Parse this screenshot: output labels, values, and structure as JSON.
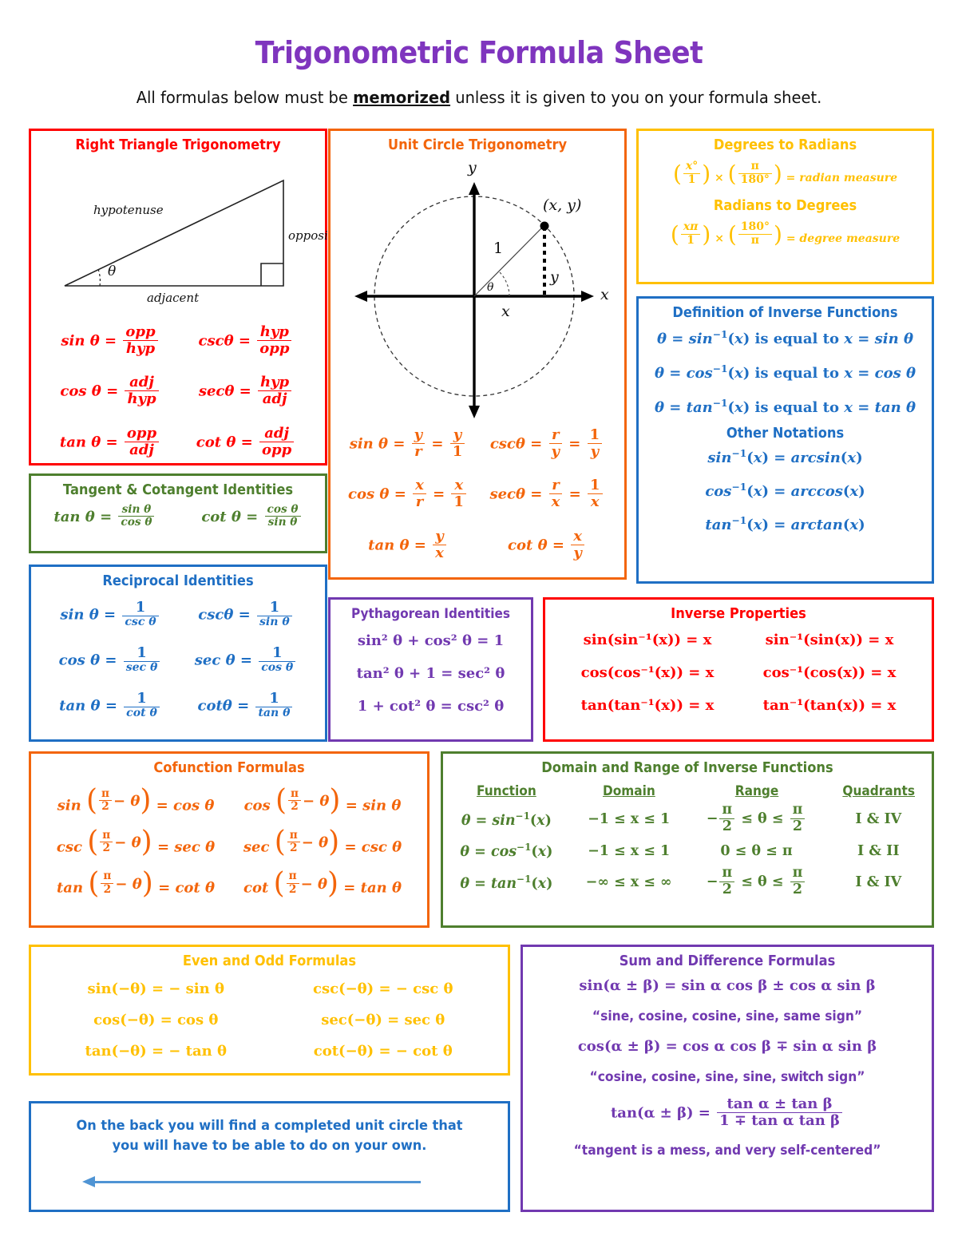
{
  "header": {
    "title": "Trigonometric Formula Sheet",
    "subtitle_before": "All formulas below must be ",
    "subtitle_emph": "memorized",
    "subtitle_after": " unless it is given to you on your formula sheet.",
    "title_color": "#7F35BE"
  },
  "colors": {
    "red": "#FF0000",
    "orange": "#F3650B",
    "gold": "#FFC000",
    "blue": "#1F6FC4",
    "green": "#4E7F2E",
    "purple": "#7139B0"
  },
  "right_triangle": {
    "title": "Right Triangle Trigonometry",
    "diagram_labels": {
      "hypotenuse": "hypotenuse",
      "opposite": "opposite",
      "adjacent": "adjacent",
      "angle": "θ"
    },
    "formulas": [
      {
        "left_fn": "sin",
        "left_num": "opp",
        "left_den": "hyp",
        "right_fn": "csc",
        "right_num": "hyp",
        "right_den": "opp"
      },
      {
        "left_fn": "cos",
        "left_num": "adj",
        "left_den": "hyp",
        "right_fn": "sec",
        "right_num": "hyp",
        "right_den": "adj"
      },
      {
        "left_fn": "tan",
        "left_num": "opp",
        "left_den": "adj",
        "right_fn": "cot",
        "right_num": "adj",
        "right_den": "opp"
      }
    ]
  },
  "unit_circle": {
    "title": "Unit Circle Trigonometry",
    "diagram_labels": {
      "y_axis": "y",
      "x_axis": "x",
      "point": "(x, y)",
      "radius": "1",
      "y_leg": "y",
      "x_leg": "x",
      "angle": "θ"
    },
    "formulas": [
      {
        "left_fn": "sin",
        "left_n1": "y",
        "left_d1": "r",
        "left_n2": "y",
        "left_d2": "1",
        "right_fn": "csc",
        "right_n1": "r",
        "right_d1": "y",
        "right_n2": "1",
        "right_d2": "y"
      },
      {
        "left_fn": "cos",
        "left_n1": "x",
        "left_d1": "r",
        "left_n2": "x",
        "left_d2": "1",
        "right_fn": "sec",
        "right_n1": "r",
        "right_d1": "x",
        "right_n2": "1",
        "right_d2": "x"
      }
    ],
    "tan_fn": "tan",
    "tan_num": "y",
    "tan_den": "x",
    "cot_fn": "cot",
    "cot_num": "x",
    "cot_den": "y"
  },
  "deg_rad": {
    "title_deg_to_rad": "Degrees to Radians",
    "deg_to_rad": {
      "n1": "x°",
      "d1": "1",
      "times": "×",
      "n2": "π",
      "d2": "180°",
      "result": "= radian measure"
    },
    "title_rad_to_deg": "Radians to Degrees",
    "rad_to_deg": {
      "n1": "xπ",
      "d1": "1",
      "times": "×",
      "n2": "180°",
      "d2": "π",
      "result": "= degree measure"
    }
  },
  "inverse_def": {
    "title": "Definition of Inverse Functions",
    "lines": [
      {
        "fn": "sin",
        "tail": "is equal to"
      },
      {
        "fn": "cos",
        "tail": "is equal to"
      },
      {
        "fn": "tan",
        "tail": "is equal to"
      }
    ],
    "other_notations_title": "Other Notations",
    "notations": [
      {
        "fn": "sin",
        "arc": "arcsin"
      },
      {
        "fn": "cos",
        "arc": "arccos"
      },
      {
        "fn": "tan",
        "arc": "arctan"
      }
    ]
  },
  "tan_cot": {
    "title": "Tangent & Cotangent Identities",
    "formulas": [
      {
        "fn": "tan",
        "num": "sin θ",
        "den": "cos θ"
      },
      {
        "fn": "cot",
        "num": "cos θ",
        "den": "sin θ"
      }
    ]
  },
  "reciprocal": {
    "title": "Reciprocal Identities",
    "formulas": [
      {
        "left_fn": "sin",
        "left_den": "csc θ",
        "right_fn": "csc",
        "right_den": "sin θ"
      },
      {
        "left_fn": "cos",
        "left_den": "sec θ",
        "right_fn": "sec",
        "right_den": "cos θ"
      },
      {
        "left_fn": "tan",
        "left_den": "cot θ",
        "right_fn": "cot",
        "right_den": "tan θ"
      }
    ],
    "one": "1"
  },
  "pythagorean": {
    "title": "Pythagorean Identities",
    "lines": [
      "sin² θ + cos² θ = 1",
      "tan² θ + 1 = sec² θ",
      "1 + cot² θ = csc² θ"
    ]
  },
  "inverse_properties": {
    "title": "Inverse Properties",
    "rows": [
      {
        "left": "sin(sin⁻¹(x)) = x",
        "right": "sin⁻¹(sin(x)) = x",
        "fn": "sin"
      },
      {
        "left": "cos(cos⁻¹(x)) = x",
        "right": "cos⁻¹(cos(x)) = x",
        "fn": "cos"
      },
      {
        "left": "tan(tan⁻¹(x)) = x",
        "right": "tan⁻¹(tan(x)) = x",
        "fn": "tan"
      }
    ]
  },
  "cofunction": {
    "title": "Cofunction Formulas",
    "rows": [
      {
        "left_fn": "sin",
        "left_res": "cos θ",
        "right_fn": "cos",
        "right_res": "sin θ"
      },
      {
        "left_fn": "csc",
        "left_res": "sec θ",
        "right_fn": "sec",
        "right_res": "csc θ"
      },
      {
        "left_fn": "tan",
        "left_res": "cot θ",
        "right_fn": "cot",
        "right_res": "tan θ"
      }
    ],
    "pi": "π",
    "two": "2",
    "minus_theta": "− θ"
  },
  "domain_range": {
    "title": "Domain and Range of Inverse Functions",
    "headers": [
      "Function",
      "Domain",
      "Range",
      "Quadrants"
    ],
    "rows": [
      {
        "function_fn": "sin",
        "domain": "−1 ≤ x ≤ 1",
        "range_type": "frac",
        "range_pre": "−",
        "range_mid": "≤ θ ≤",
        "quadrants": "I & IV"
      },
      {
        "function_fn": "cos",
        "domain": "−1 ≤ x ≤ 1",
        "range_type": "plain",
        "range_plain": "0 ≤ θ ≤ π",
        "quadrants": "I & II"
      },
      {
        "function_fn": "tan",
        "domain": "−∞ ≤ x ≤ ∞",
        "range_type": "frac",
        "range_pre": "−",
        "range_mid": "≤ θ ≤",
        "quadrants": "I & IV"
      }
    ],
    "pi": "π",
    "two": "2"
  },
  "even_odd": {
    "title": "Even and Odd Formulas",
    "rows": [
      {
        "left": "sin(−θ) = − sin θ",
        "right": "csc(−θ) = − csc θ"
      },
      {
        "left": "cos(−θ) = cos θ",
        "right": "sec(−θ) = sec θ"
      },
      {
        "left": "tan(−θ) = − tan θ",
        "right": "cot(−θ) = − cot θ"
      }
    ]
  },
  "sum_diff": {
    "title": "Sum and Difference Formulas",
    "sin_formula": "sin(α ± β) = sin α cos β ± cos α sin β",
    "sin_mnemonic": "“sine, cosine, cosine, sine, same sign”",
    "cos_formula": "cos(α ± β) = cos α cos β ∓ sin α sin β",
    "cos_mnemonic_before": "“cosine, cosine, sine, sine, ",
    "cos_mnemonic_emph": "switch",
    "cos_mnemonic_after": " sign”",
    "tan_lhs": "tan(α ± β) =",
    "tan_num": "tan α ± tan β",
    "tan_den": "1 ∓ tan α tan β",
    "tan_mnemonic": "“tangent is a mess, and very self-centered”"
  },
  "back_note": {
    "text": "On the back you will find a completed unit circle that you will have to be able to do on your own.",
    "arrow_color": "#4F94D4"
  }
}
